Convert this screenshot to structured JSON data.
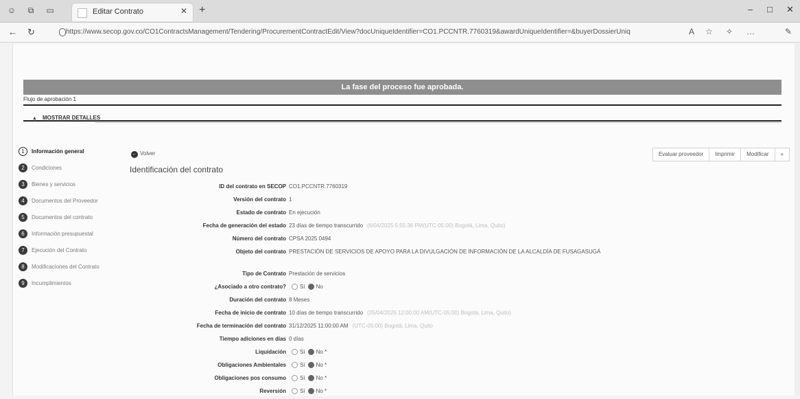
{
  "browser": {
    "tab_title": "Editar Contrato",
    "url": "https://www.secop.gov.co/CO1ContractsManagement/Tendering/ProcurementContractEdit/View?docUniqueIdentifier=CO1.PCCNTR.7760319&awardUniqueIdentifier=&buyerDossierUniq",
    "icons": [
      "back-icon",
      "refresh-icon",
      "lock-icon",
      "read-aloud-icon",
      "favorites-icon",
      "collections-icon",
      "more-icon"
    ]
  },
  "page": {
    "banner": "La fase del proceso fue aprobada.",
    "approval_flow": "Flujo de aprobación 1",
    "details_toggle": "MOSTRAR DETALLES",
    "back": "Volver",
    "section_title": "Identificación del contrato",
    "actions": [
      "Evaluar proveedor",
      "Imprimir",
      "Modificar",
      "»"
    ]
  },
  "steps": [
    {
      "num": "1",
      "label": "Información general"
    },
    {
      "num": "2",
      "label": "Condiciones"
    },
    {
      "num": "3",
      "label": "Bienes y servicios"
    },
    {
      "num": "4",
      "label": "Documentos del Proveedor"
    },
    {
      "num": "5",
      "label": "Documentos del contrato"
    },
    {
      "num": "6",
      "label": "Información presupuestal"
    },
    {
      "num": "7",
      "label": "Ejecución del Contrato"
    },
    {
      "num": "8",
      "label": "Modificaciones del Contrato"
    },
    {
      "num": "9",
      "label": "Incumplimientos"
    }
  ],
  "fields": {
    "id": {
      "label": "ID del contrato en SECOP",
      "value": "CO1.PCCNTR.7760319"
    },
    "version": {
      "label": "Versión del contrato",
      "value": "1"
    },
    "estado": {
      "label": "Estado de contrato",
      "value": "En ejecución"
    },
    "fecha_estado": {
      "label": "Fecha de generación del estado",
      "value": "23 días de tiempo transcurrido",
      "faint": "(6/04/2025 5:55:36 PM(UTC-05:00) Bogotá, Lima, Quito)"
    },
    "numero": {
      "label": "Número del contrato",
      "value": "CPSA 2025 0494"
    },
    "objeto": {
      "label": "Objeto del contrato",
      "value": "Prestación de servicios de apoyo para la divulgación de información de la Alcaldía de Fusagasugá"
    },
    "tipo": {
      "label": "Tipo de Contrato",
      "value": "Prestación de servicios"
    },
    "asociado": {
      "label": "¿Asociado a otro contrato?",
      "yes": "Sí",
      "no": "No"
    },
    "duracion": {
      "label": "Duración del contrato",
      "value": "8 Meses"
    },
    "fecha_inicio": {
      "label": "Fecha de inicio de contrato",
      "value": "10 días de tiempo transcurrido",
      "faint": "(25/04/2025 12:00:00 AM(UTC-05:00) Bogotá, Lima, Quito)"
    },
    "fecha_fin": {
      "label": "Fecha de terminación del contrato",
      "value": "31/12/2025 11:00:00 AM",
      "faint": "(UTC-05:00) Bogotá, Lima, Quito"
    },
    "tiempo_adiciones": {
      "label": "Tiempo adiciones en días",
      "value": "0 días"
    },
    "liquidacion": {
      "label": "Liquidación",
      "yes": "Sí",
      "no": "No *"
    },
    "obligaciones_amb": {
      "label": "Obligaciones Ambientales",
      "yes": "Sí",
      "no": "No *"
    },
    "obligaciones_pos": {
      "label": "Obligaciones pos consumo",
      "yes": "Sí",
      "no": "No *"
    },
    "reversion": {
      "label": "Reversión",
      "yes": "Sí",
      "no": "No *"
    }
  }
}
